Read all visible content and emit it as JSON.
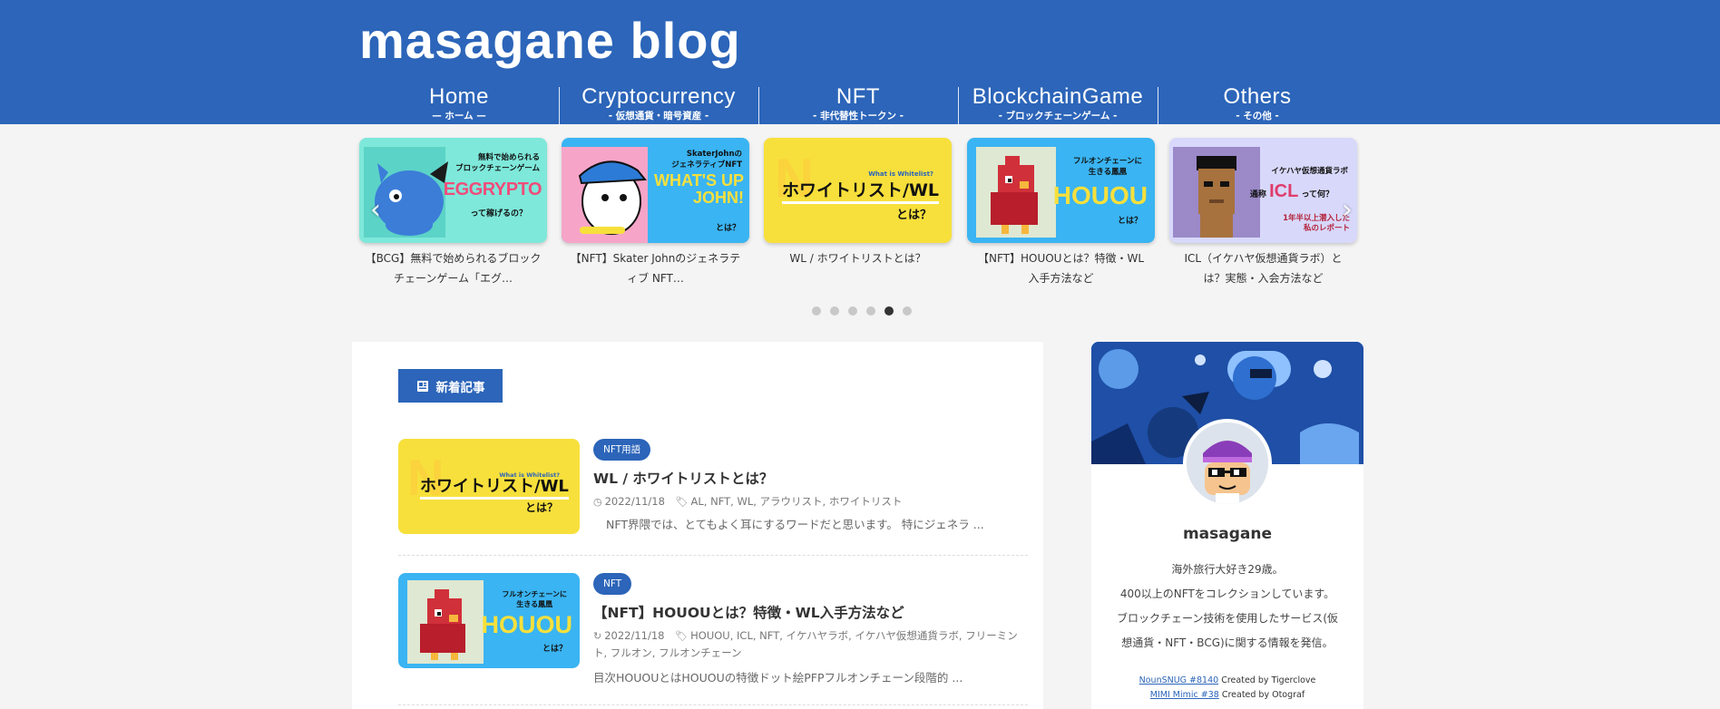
{
  "site": {
    "logo": "masagane blog"
  },
  "nav": [
    {
      "label": "Home",
      "sub": "— ホーム —"
    },
    {
      "label": "Cryptocurrency",
      "sub": "- 仮想通貨・暗号資産 -"
    },
    {
      "label": "NFT",
      "sub": "- 非代替性トークン -"
    },
    {
      "label": "BlockchainGame",
      "sub": "- ブロックチェーンゲーム -"
    },
    {
      "label": "Others",
      "sub": "- その他 -"
    }
  ],
  "carousel": {
    "slides": [
      {
        "title": "【BCG】無料で始められるブロックチェーンゲーム「エグ…",
        "thumb": {
          "bg": "#7ee8da",
          "l1": "無料で始められる",
          "l2": "ブロックチェーンゲーム",
          "big": "EGGRYPTO",
          "l3": "って稼げるの？"
        }
      },
      {
        "title": "【NFT】Skater Johnのジェネラティブ NFT…",
        "thumb": {
          "bg": "#3ab4f2",
          "l1": "SkaterJohnの",
          "l2": "ジェネラティブNFT",
          "big": "WHAT'S UP JOHN!",
          "l3": "とは？"
        }
      },
      {
        "title": "WL / ホワイトリストとは？",
        "thumb": {
          "bg": "#f7e03c",
          "l1": "What is Whitelist?",
          "big": "ホワイトリスト/WL",
          "l3": "とは？"
        }
      },
      {
        "title": "【NFT】HOUOUとは？特徴・WL入手方法など",
        "thumb": {
          "bg": "#3ab4f2",
          "l1": "フルオンチェーンに",
          "l2": "生きる鳳凰",
          "big": "HOUOU",
          "l3": "とは？"
        }
      },
      {
        "title": "ICL（イケハヤ仮想通貨ラボ）とは？実態・入会方法など",
        "thumb": {
          "bg": "#d8d8fb",
          "l1": "イケハヤ仮想通貨ラボ",
          "l2": "通称",
          "big": "ICL",
          "l3": "って何？",
          "l4": "1年半以上潜入した",
          "l5": "私のレポート"
        }
      }
    ],
    "dots": 6,
    "active_dot": 5
  },
  "section": {
    "heading": "新着記事"
  },
  "articles": [
    {
      "category": "NFT用語",
      "title": "WL / ホワイトリストとは？",
      "date": "2022/11/18",
      "tags": "AL, NFT, WL, アラウリスト, ホワイトリスト",
      "excerpt": "NFT界隈では、とてもよく耳にするワードだと思います。 特にジェネラ ...",
      "thumb": {
        "bg": "#f7e03c",
        "l1": "What is Whitelist?",
        "big": "ホワイトリスト/WL",
        "l3": "とは？"
      }
    },
    {
      "category": "NFT",
      "title": "【NFT】HOUOUとは？特徴・WL入手方法など",
      "date": "2022/11/18",
      "tags": "HOUOU, ICL, NFT, イケハヤラボ, イケハヤ仮想通貨ラボ, フリーミント, フルオン, フルオンチェーン",
      "excerpt": "目次HOUOUとはHOUOUの特徴ドット絵PFPフルオンチェーン段階的 ...",
      "thumb": {
        "bg": "#3ab4f2",
        "l1": "フルオンチェーンに",
        "l2": "生きる鳳凰",
        "big": "HOUOU",
        "l3": "とは？"
      }
    }
  ],
  "profile": {
    "name": "masagane",
    "bio": [
      "海外旅行大好き29歳。",
      "400以上のNFTをコレクションしています。",
      "ブロックチェーン技術を使用したサービス(仮",
      "想通貨・NFT・BCG)に関する情報を発信。"
    ],
    "credits": [
      {
        "link": "NounSNUG #8140",
        "text": " Created by Tigerclove"
      },
      {
        "link": "MIMI Mimic #38",
        "text": " Created by Otograf"
      }
    ]
  },
  "colors": {
    "brand": "#2c65b9",
    "page_bg": "#f4f4f4"
  }
}
